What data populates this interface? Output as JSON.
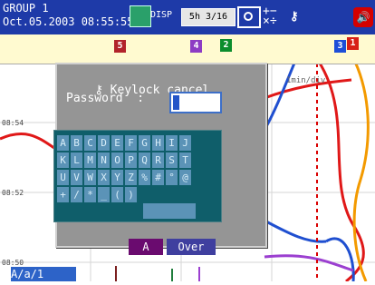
{
  "header": {
    "group": "GROUP 1",
    "datetime": "Oct.05.2003 08:55:55",
    "disp": "DISP",
    "page": "5h 3/16"
  },
  "chart": {
    "times": [
      "08:54",
      "08:52",
      "08:50"
    ],
    "scale": "1min/div",
    "markers": [
      {
        "label": "5",
        "color": "#b2232a"
      },
      {
        "label": "4",
        "color": "#8d3cc4"
      },
      {
        "label": "2",
        "color": "#0b8d2d"
      },
      {
        "label": "3",
        "color": "#1d4ed8"
      },
      {
        "label": "1",
        "color": "#d82017"
      }
    ]
  },
  "dialog": {
    "title": "Keylock cancel",
    "password_label": "Password  :",
    "keys": [
      "A",
      "B",
      "C",
      "D",
      "E",
      "F",
      "G",
      "H",
      "I",
      "J",
      "K",
      "L",
      "M",
      "N",
      "O",
      "P",
      "Q",
      "R",
      "S",
      "T",
      "U",
      "V",
      "W",
      "X",
      "Y",
      "Z",
      "%",
      "#",
      "°",
      "@",
      "+",
      "/",
      "*",
      "_",
      "(",
      ")"
    ],
    "mode_button": "A",
    "over_button": "Over"
  },
  "footer": {
    "tab_label": "A/a/1"
  },
  "icons": {
    "status": "status-icon",
    "disp": "display-icon",
    "box": "camera-icon",
    "math": "math-icon",
    "key": "key-icon",
    "speaker": "speaker-icon"
  },
  "colors": {
    "topbar": "#1e3aa8",
    "dialog": "#959595",
    "keyboard": "#0f5e6a",
    "key": "#5b93b7",
    "mode_button": "#6a0b6f",
    "over_button": "#3f3f9f",
    "strip": "#fffad0"
  }
}
